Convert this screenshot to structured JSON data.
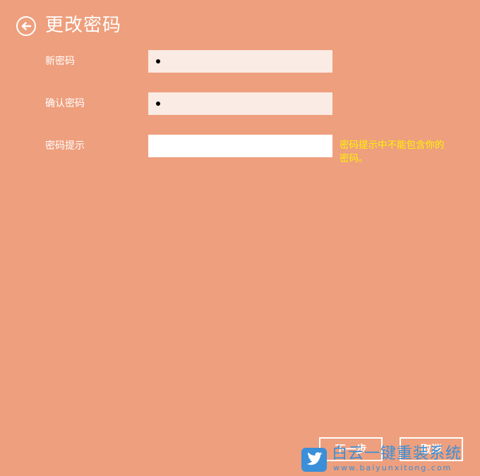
{
  "header": {
    "back_icon": "back-arrow-circle-icon",
    "title": "更改密码"
  },
  "form": {
    "new_password": {
      "label": "新密码",
      "value": "•"
    },
    "confirm_password": {
      "label": "确认密码",
      "value": "•"
    },
    "password_hint": {
      "label": "密码提示",
      "value": "",
      "warning": "密码提示中不能包含你的密码。"
    }
  },
  "buttons": {
    "next_label": "下一步",
    "cancel_label": "取消"
  },
  "watermark": {
    "title": "白云一键重装系统",
    "url": "www.baiyunxitong.com",
    "icon": "twitter-bird-icon"
  },
  "colors": {
    "background": "#EE9F7D",
    "password_field": "#FAEBE4",
    "hint_field": "#FFFFFF",
    "warning_text": "#FFF200",
    "watermark": "#3A8FD8"
  }
}
